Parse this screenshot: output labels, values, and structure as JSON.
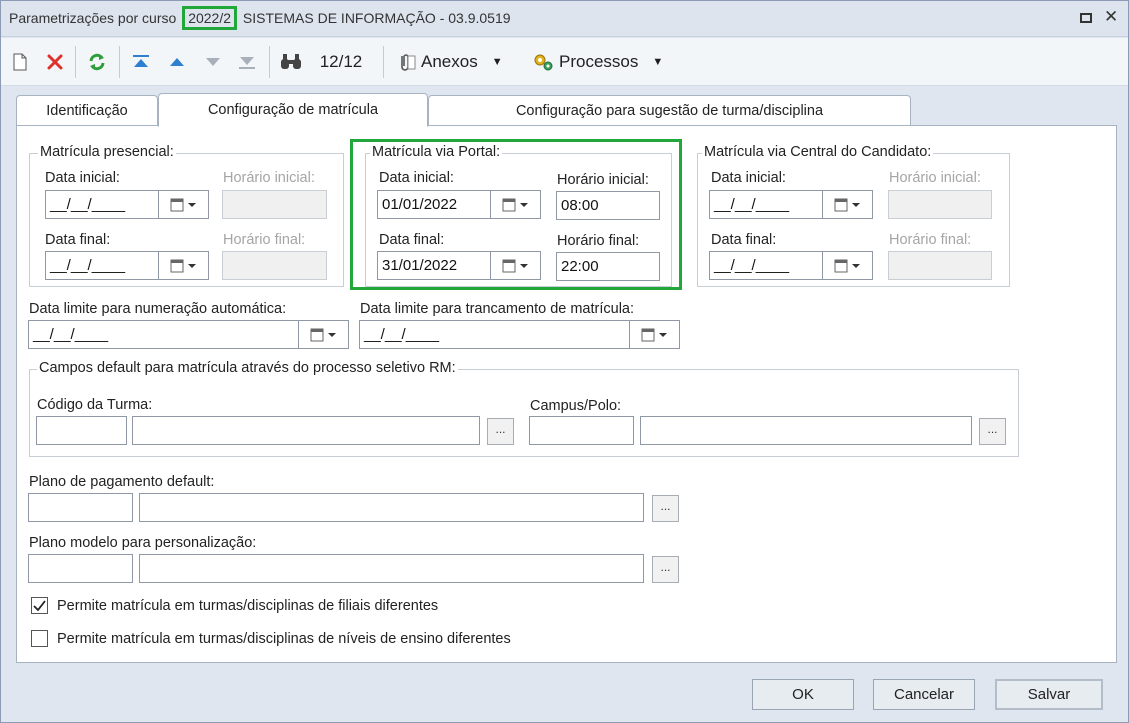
{
  "titlebar": {
    "prefix": "Parametrizações por curso",
    "period": "2022/2",
    "course": "SISTEMAS DE INFORMAÇÃO - 03.9.0519"
  },
  "toolbar": {
    "record_counter": "12/12",
    "attachments_label": "Anexos",
    "processes_label": "Processos"
  },
  "tabs": [
    {
      "label": "Identificação"
    },
    {
      "label": "Configuração de matrícula"
    },
    {
      "label": "Configuração para sugestão de turma/disciplina"
    }
  ],
  "presencial": {
    "legend": "Matrícula presencial:",
    "start_date_label": "Data inicial:",
    "start_date_value": "__/__/____",
    "start_time_label": "Horário inicial:",
    "end_date_label": "Data final:",
    "end_date_value": "__/__/____",
    "end_time_label": "Horário final:"
  },
  "portal": {
    "legend": "Matrícula via Portal:",
    "start_date_label": "Data inicial:",
    "start_date_value": "01/01/2022",
    "start_time_label": "Horário inicial:",
    "start_time_value": "08:00",
    "end_date_label": "Data final:",
    "end_date_value": "31/01/2022",
    "end_time_label": "Horário final:",
    "end_time_value": "22:00"
  },
  "central": {
    "legend": "Matrícula via Central do Candidato:",
    "start_date_label": "Data inicial:",
    "start_date_value": "__/__/____",
    "start_time_label": "Horário inicial:",
    "end_date_label": "Data final:",
    "end_date_value": "__/__/____",
    "end_time_label": "Horário final:"
  },
  "limits": {
    "auto_number_label": "Data limite para numeração automática:",
    "auto_number_value": "__/__/____",
    "lock_label": "Data limite para trancamento de matrícula:",
    "lock_value": "__/__/____"
  },
  "default_fields": {
    "legend": "Campos default para matrícula através do processo seletivo RM:",
    "class_code_label": "Código da Turma:",
    "campus_label": "Campus/Polo:"
  },
  "payment_plan": {
    "label": "Plano de pagamento default:"
  },
  "model_plan": {
    "label": "Plano modelo para personalização:"
  },
  "checks": [
    {
      "label": "Permite matrícula em turmas/disciplinas de filiais diferentes",
      "checked": true
    },
    {
      "label": "Permite matrícula em turmas/disciplinas de níveis de ensino diferentes",
      "checked": false
    }
  ],
  "buttons": {
    "dots": "...",
    "ok": "OK",
    "cancel": "Cancelar",
    "save": "Salvar"
  },
  "colors": {
    "highlight": "#22a83a",
    "delete_red": "#e0302a",
    "refresh_green": "#2e9e3a",
    "nav_blue": "#2f7fd0"
  }
}
